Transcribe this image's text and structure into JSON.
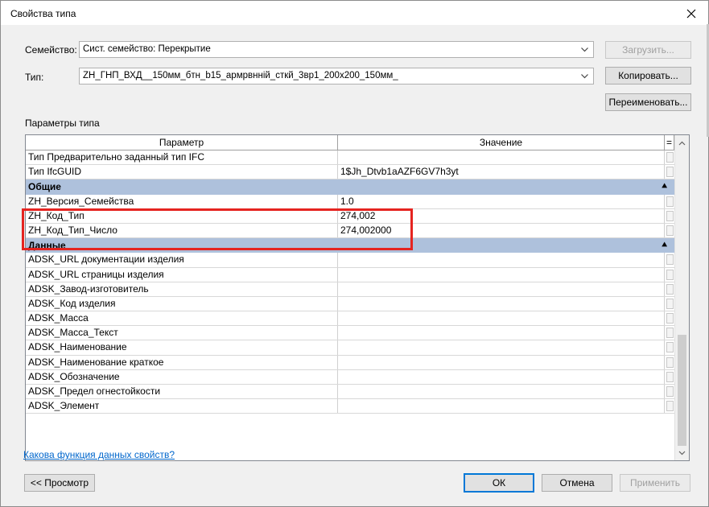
{
  "dialog": {
    "title": "Свойства типа"
  },
  "family": {
    "label": "Семейство:",
    "value": "Сист. семейство: Перекрытие",
    "load_button": "Загрузить..."
  },
  "type": {
    "label": "Тип:",
    "value": "ZH_ГНП_ВХД__150мм_бтн_b15_армрвнній_сткй_3вр1_200х200_150мм_",
    "copy_button": "Копировать...",
    "rename_button": "Переименовать..."
  },
  "params": {
    "section_label": "Параметры типа",
    "col_param": "Параметр",
    "col_value": "Значение",
    "col_eq": "=",
    "rows_top": [
      {
        "name": "Тип Предварительно заданный тип IFC",
        "value": ""
      },
      {
        "name": "Тип IfcGUID",
        "value": "1$Jh_Dtvb1aAZF6GV7h3yt"
      }
    ],
    "group_general": "Общие",
    "rows_general": [
      {
        "name": "ZH_Версия_Семейства",
        "value": "1.0"
      },
      {
        "name": "ZH_Код_Тип",
        "value": "274,002"
      },
      {
        "name": "ZH_Код_Тип_Число",
        "value": "274,002000"
      }
    ],
    "group_data": "Данные",
    "rows_data": [
      {
        "name": "ADSK_URL документации изделия",
        "value": ""
      },
      {
        "name": "ADSK_URL страницы изделия",
        "value": ""
      },
      {
        "name": "ADSK_Завод-изготовитель",
        "value": ""
      },
      {
        "name": "ADSK_Код изделия",
        "value": ""
      },
      {
        "name": "ADSK_Масса",
        "value": ""
      },
      {
        "name": "ADSK_Масса_Текст",
        "value": ""
      },
      {
        "name": "ADSK_Наименование",
        "value": ""
      },
      {
        "name": "ADSK_Наименование краткое",
        "value": ""
      },
      {
        "name": "ADSK_Обозначение",
        "value": ""
      },
      {
        "name": "ADSK_Предел огнестойкости",
        "value": ""
      },
      {
        "name": "ADSK_Элемент",
        "value": ""
      }
    ]
  },
  "footer": {
    "help_link": "Какова функция данных свойств?",
    "preview_button": "<< Просмотр",
    "ok_button": "ОК",
    "cancel_button": "Отмена",
    "apply_button": "Применить"
  },
  "colors": {
    "group_header": "#aec1dc",
    "highlight": "#e52420",
    "primary_border": "#0078d7",
    "link": "#0066cc"
  }
}
